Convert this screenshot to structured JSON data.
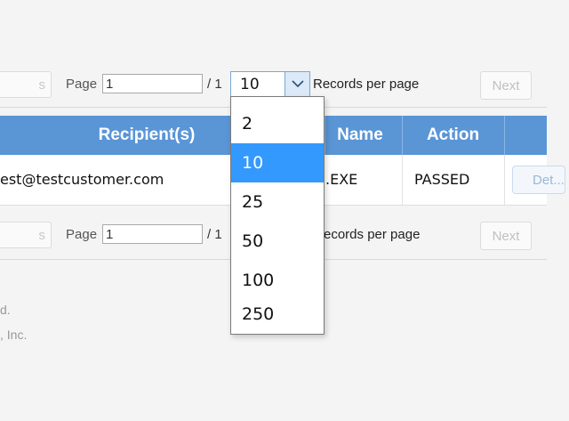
{
  "pager_top": {
    "prev_label": "s",
    "page_label": "Page",
    "page_value": "1",
    "total_label": "/ 1",
    "records_label": "Records per page",
    "next_label": "Next"
  },
  "records_select": {
    "selected": "10",
    "options": [
      "2",
      "10",
      "25",
      "50",
      "100",
      "250"
    ]
  },
  "table": {
    "headers": [
      "Recipient(s)",
      "Name",
      "Action"
    ],
    "rows": [
      {
        "recipient": "est@testcustomer.com",
        "name": ".EXE",
        "action": "PASSED",
        "details_label": "Det..."
      }
    ]
  },
  "pager_bottom": {
    "prev_label": "s",
    "page_label": "Page",
    "page_value": "1",
    "total_label": "/ 1",
    "records_label": "ecords per page",
    "next_label": "Next"
  },
  "footer": {
    "line1": "d.",
    "line2": ", Inc."
  },
  "colors": {
    "header_bg": "#5a95d6",
    "selected_option_bg": "#3399ff",
    "select_border": "#7aa7d8"
  }
}
